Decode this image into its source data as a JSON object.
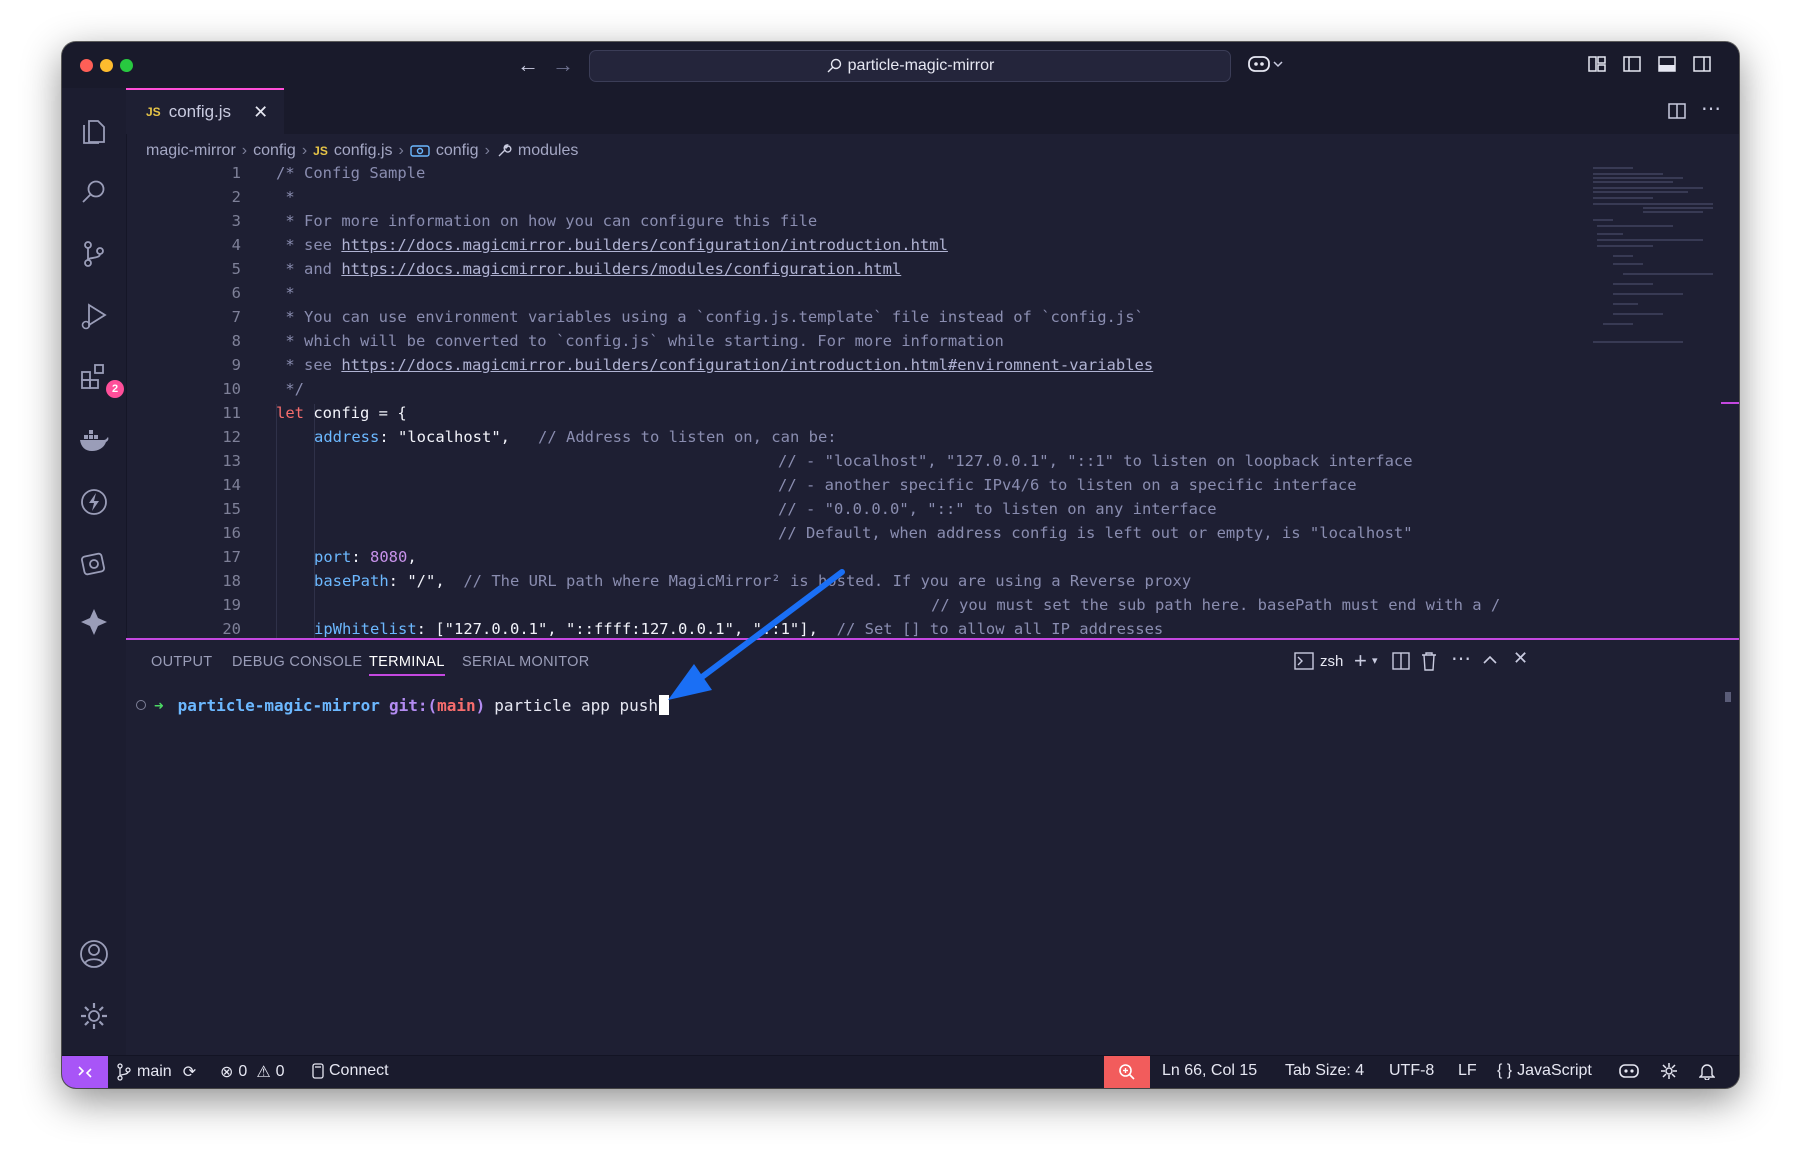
{
  "window": {
    "search_text": "particle-magic-mirror"
  },
  "tab": {
    "badge": "JS",
    "filename": "config.js",
    "close": "✕"
  },
  "breadcrumb": {
    "items": [
      "magic-mirror",
      "config",
      "config.js",
      "config",
      "modules"
    ]
  },
  "activity": {
    "extensions_badge": "2"
  },
  "editor": {
    "lines": [
      {
        "n": "1"
      },
      {
        "n": "2"
      },
      {
        "n": "3"
      },
      {
        "n": "4"
      },
      {
        "n": "5"
      },
      {
        "n": "6"
      },
      {
        "n": "7"
      },
      {
        "n": "8"
      },
      {
        "n": "9"
      },
      {
        "n": "10"
      },
      {
        "n": "11"
      },
      {
        "n": "12"
      },
      {
        "n": "13"
      },
      {
        "n": "14"
      },
      {
        "n": "15"
      },
      {
        "n": "16"
      },
      {
        "n": "17"
      },
      {
        "n": "18"
      },
      {
        "n": "19"
      },
      {
        "n": "20"
      }
    ],
    "code": {
      "l1": "/* Config Sample",
      "l2": " *",
      "l3": " * For more information on how you can configure this file",
      "l4_pre": " * see ",
      "l4_link": "https://docs.magicmirror.builders/configuration/introduction.html",
      "l5_pre": " * and ",
      "l5_link": "https://docs.magicmirror.builders/modules/configuration.html",
      "l6": " *",
      "l7": " * You can use environment variables using a `config.js.template` file instead of `config.js`",
      "l8": " * which will be converted to `config.js` while starting. For more information",
      "l9_pre": " * see ",
      "l9_link": "https://docs.magicmirror.builders/configuration/introduction.html#enviromnent-variables",
      "l10": " */",
      "l11_kw": "let",
      "l11_id": " config ",
      "l11_rest": "= {",
      "l12_prop": "address",
      "l12_colon": ": ",
      "l12_str": "\"localhost\"",
      "l12_comma": ",",
      "l12_comment": "   // Address to listen on, can be:",
      "l13": "// - \"localhost\", \"127.0.0.1\", \"::1\" to listen on loopback interface",
      "l14": "// - another specific IPv4/6 to listen on a specific interface",
      "l15": "// - \"0.0.0.0\", \"::\" to listen on any interface",
      "l16": "// Default, when address config is left out or empty, is \"localhost\"",
      "l17_prop": "port",
      "l17_colon": ": ",
      "l17_num": "8080",
      "l17_comma": ",",
      "l18_prop": "basePath",
      "l18_colon": ": ",
      "l18_str": "\"/\"",
      "l18_comma": ",",
      "l18_comment": "  // The URL path where MagicMirror² is hosted. If you are using a Reverse proxy",
      "l19": "// you must set the sub path here. basePath must end with a /",
      "l20_prop": "ipWhitelist",
      "l20_colon": ": ",
      "l20_str": "[\"127.0.0.1\", \"::ffff:127.0.0.1\", \"::1\"]",
      "l20_comma": ",",
      "l20_comment": "  // Set [] to allow all IP addresses"
    }
  },
  "panel": {
    "tabs": [
      "OUTPUT",
      "DEBUG CONSOLE",
      "TERMINAL",
      "SERIAL MONITOR"
    ],
    "active_tab": "TERMINAL",
    "shell": "zsh",
    "prompt_arrow": "➜",
    "prompt_dir": "particle-magic-mirror",
    "prompt_git": "git:(",
    "prompt_branch": "main",
    "prompt_git_close": ")",
    "command": "particle app push"
  },
  "status": {
    "branch": "main",
    "errors": "0",
    "warnings": "0",
    "connect": "Connect",
    "position": "Ln 66, Col 15",
    "tab_size": "Tab Size: 4",
    "encoding": "UTF-8",
    "eol": "LF",
    "language_braces": "{ }",
    "language": "JavaScript"
  },
  "colors": {
    "accent": "#c448e0",
    "annotation_arrow": "#1a6ff5",
    "remote": "#a855f7",
    "zoom": "#f25c5c"
  }
}
